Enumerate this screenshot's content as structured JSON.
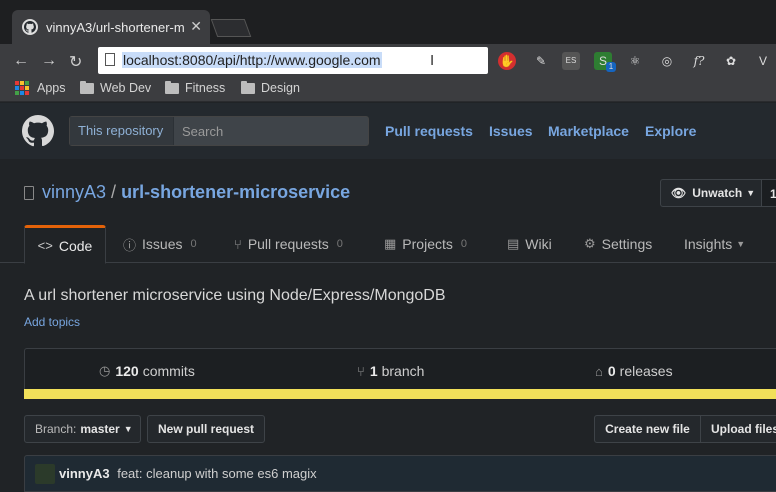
{
  "browser": {
    "tab_title": "vinnyA3/url-shortener-m",
    "tab_close": "✕",
    "url": "localhost:8080/api/http://www.google.com",
    "nav": {
      "back": "←",
      "forward": "→",
      "reload": "↻"
    },
    "menu": "⋮",
    "extensions": [
      "ublock-icon",
      "eyedropper-icon",
      "es-icon",
      "skype-icon",
      "react-icon",
      "target-icon",
      "function-icon",
      "evernote-icon",
      "vue-icon"
    ],
    "ext_f_label": "f?",
    "ext_es_label": "ES",
    "ext_badge": "1"
  },
  "bookmarks": [
    {
      "label": "Apps"
    },
    {
      "label": "Web Dev"
    },
    {
      "label": "Fitness"
    },
    {
      "label": "Design"
    }
  ],
  "github": {
    "search_scope": "This repository",
    "search_placeholder": "Search",
    "nav": [
      "Pull requests",
      "Issues",
      "Marketplace",
      "Explore"
    ]
  },
  "repo": {
    "owner": "vinnyA3",
    "separator": "/",
    "name": "url-shortener-microservice",
    "watch_label": "Unwatch",
    "watch_count": "1",
    "tabs": [
      {
        "label": "Code",
        "count": "",
        "icon": "<>"
      },
      {
        "label": "Issues",
        "count": "0",
        "icon": "ⓘ"
      },
      {
        "label": "Pull requests",
        "count": "0",
        "icon": "⑂"
      },
      {
        "label": "Projects",
        "count": "0",
        "icon": "▦"
      },
      {
        "label": "Wiki",
        "count": "",
        "icon": "▤"
      },
      {
        "label": "Settings",
        "count": "",
        "icon": "⚙"
      },
      {
        "label": "Insights",
        "count": "",
        "icon": ""
      }
    ],
    "description": "A url shortener microservice using Node/Express/MongoDB",
    "add_topics": "Add topics",
    "summary": {
      "commits_num": "120",
      "commits_label": "commits",
      "branch_num": "1",
      "branch_label": "branch",
      "releases_num": "0",
      "releases_label": "releases"
    },
    "branch_prefix": "Branch:",
    "branch_name": "master",
    "new_pr": "New pull request",
    "create_file": "Create new file",
    "upload_files": "Upload files",
    "commit_author": "vinnyA3",
    "commit_message": "feat: cleanup with some es6 magix"
  },
  "colors": {
    "accent_link": "#78a6e0",
    "lang_bar": "#f1e05a",
    "selected_tab_border": "#e36209"
  }
}
